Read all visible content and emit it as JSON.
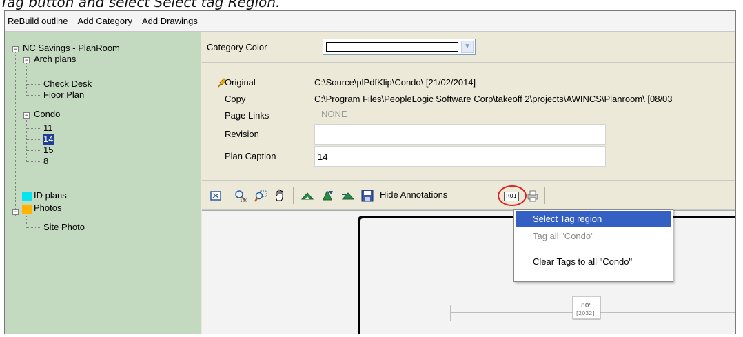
{
  "caption": "Tag button and select Select tag Region.",
  "menubar": {
    "items": [
      "ReBuild outline",
      "Add Category",
      "Add Drawings"
    ]
  },
  "tree": {
    "root": "NC Savings - PlanRoom",
    "arch_plans": "Arch plans",
    "check_desk": "Check Desk",
    "floor_plan": "Floor Plan",
    "condo": "Condo",
    "condo_11": "11",
    "condo_14": "14",
    "condo_15": "15",
    "condo_8": "8",
    "id_plans": "ID plans",
    "photos": "Photos",
    "site_photo": "Site Photo"
  },
  "category": {
    "label": "Category Color",
    "color_value": "#ffffff"
  },
  "info": {
    "original_label": "Original",
    "original_value": "C:\\Source\\plPdfKlip\\Condo\\ [21/02/2014]",
    "copy_label": "Copy",
    "copy_value": "C:\\Program Files\\PeopleLogic Software Corp\\takeoff 2\\projects\\AWINCS\\Planroom\\ [08/03",
    "page_links_label": "Page Links",
    "page_links_value": "NONE",
    "revision_label": "Revision",
    "revision_value": "",
    "plan_caption_label": "Plan Caption",
    "plan_caption_value": "14"
  },
  "toolbar": {
    "hide_annotations": "Hide Annotations",
    "tag_button_text": "R01"
  },
  "context_menu": {
    "items": [
      "Select Tag region",
      "Tag all \"Condo\"",
      "Clear Tags to all \"Condo\""
    ]
  },
  "drawing": {
    "dim_text": "80'",
    "dim_subtext": "[2032]"
  },
  "colors": {
    "tree_bg": "#c3d9c0",
    "selection": "#1f3f95",
    "menu_highlight": "#3460c4",
    "id_plans_swatch": "#00e5f0",
    "photos_swatch": "#ffb200",
    "callout_circle": "#e02020"
  }
}
